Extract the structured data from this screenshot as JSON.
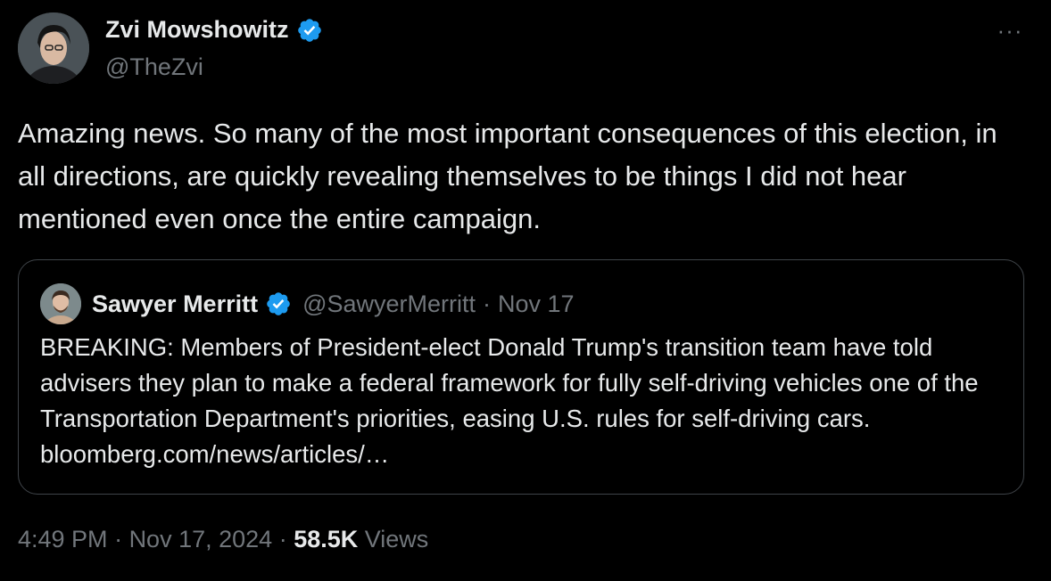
{
  "author": {
    "display_name": "Zvi Mowshowitz",
    "handle": "@TheZvi",
    "verified": true,
    "avatar": "avatar-photo"
  },
  "more_icon": "ellipsis-icon",
  "more_label": "···",
  "tweet_text": "Amazing news. So many of the most important consequences of this election, in all directions, are quickly revealing themselves to be things I did not hear mentioned even once the entire campaign.",
  "quote": {
    "display_name": "Sawyer Merritt",
    "handle": "@SawyerMerritt",
    "separator": "·",
    "date": "Nov 17",
    "verified": true,
    "text": "BREAKING: Members of President-elect Donald Trump's transition team have told advisers they plan to make a federal framework for fully self-driving vehicles one of the Transportation Department's priorities, easing U.S. rules for self-driving cars. bloomberg.com/news/articles/…"
  },
  "footer": {
    "time": "4:49 PM",
    "sep1": " · ",
    "date": "Nov 17, 2024",
    "sep2": " · ",
    "views_count": "58.5K",
    "views_label": " Views"
  },
  "colors": {
    "background": "#000000",
    "text": "#e7e9ea",
    "secondary": "#71767b",
    "verified": "#1d9bf0",
    "border": "#3f4449"
  }
}
